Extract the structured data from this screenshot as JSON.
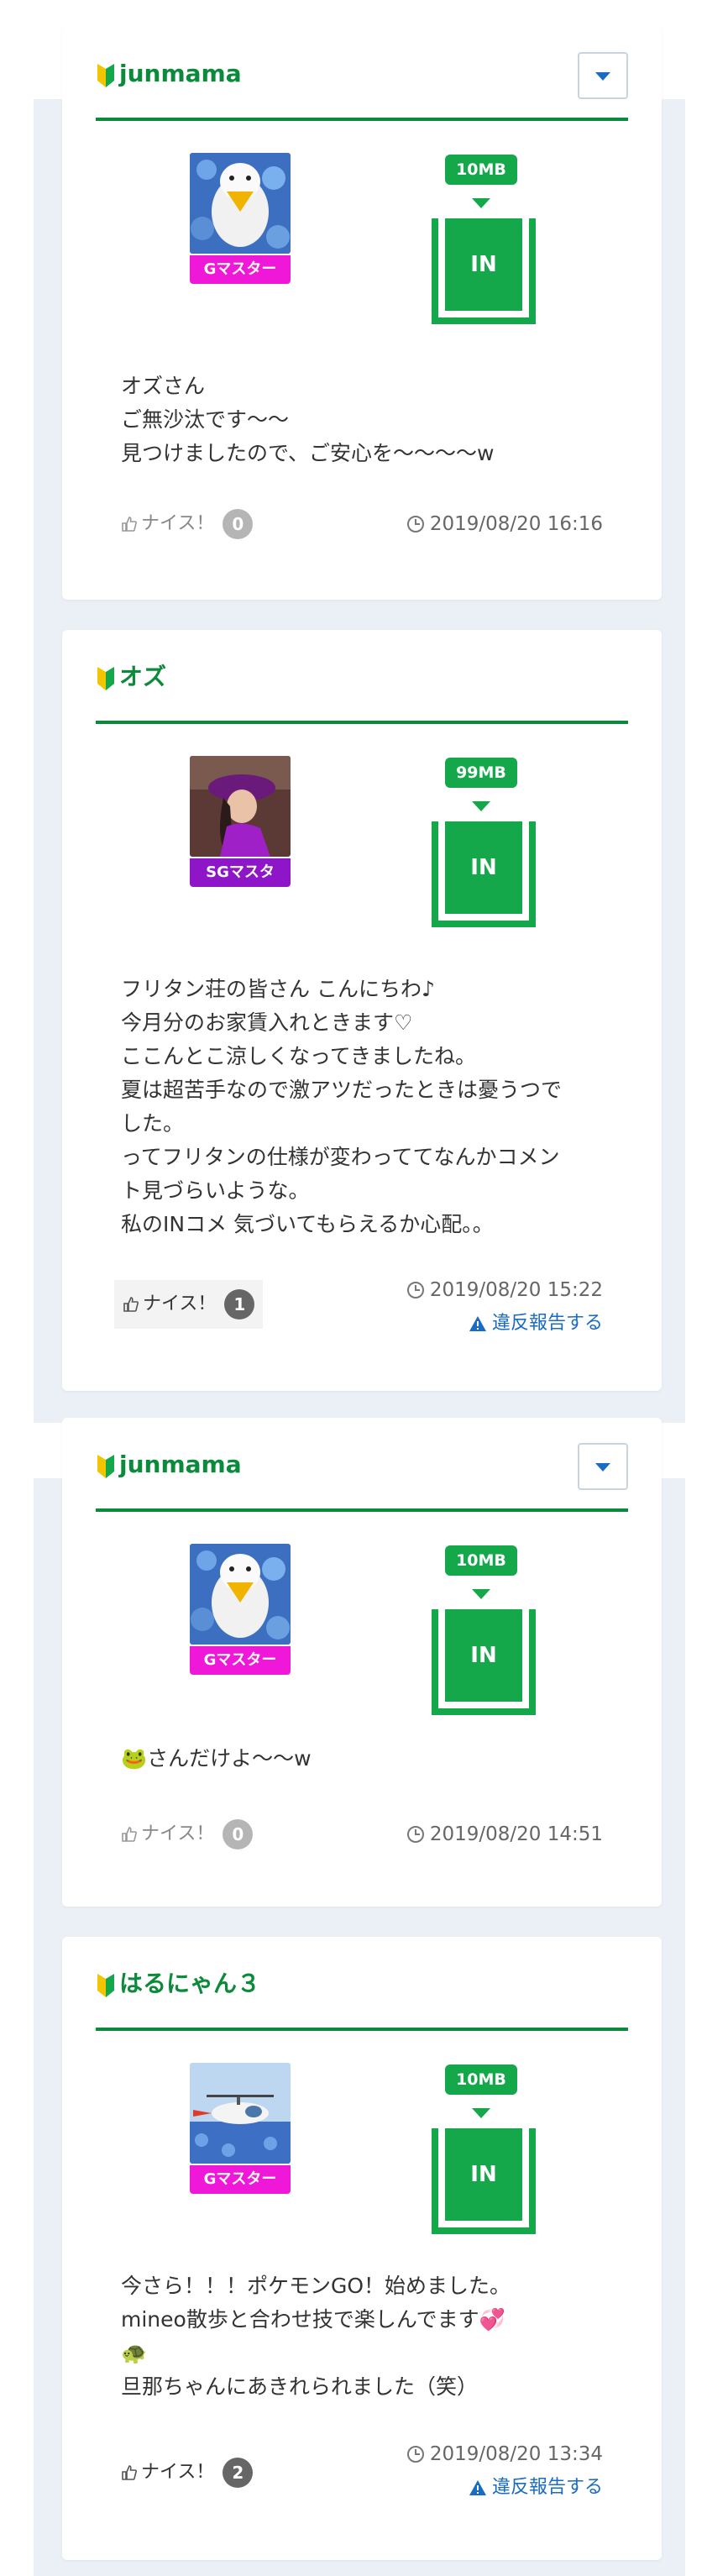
{
  "posts": [
    {
      "username": "junmama",
      "rank": "Gマスター",
      "rank_color": "#f018d8",
      "amount": "10MB",
      "direction": "IN",
      "body": [
        "オズさん",
        "ご無沙汰です〜〜",
        "見つけましたので、ご安心を〜〜〜〜w"
      ],
      "nice_label": "ナイス！",
      "nice_count": "0",
      "timestamp": "2019/08/20 16:16"
    },
    {
      "username": "オズ",
      "rank": "SGマスタ",
      "rank_color": "#8e16c8",
      "amount": "99MB",
      "direction": "IN",
      "body": [
        "フリタン荘の皆さん こんにちわ♪",
        "今月分のお家賃入れときます♡",
        "ここんとこ涼しくなってきましたね。",
        "夏は超苦手なので激アツだったときは憂うつで",
        "した。",
        "ってフリタンの仕様が変わっててなんかコメン",
        "ト見づらいような。",
        "私のINコメ 気づいてもらえるか心配。。"
      ],
      "nice_label": "ナイス！",
      "nice_count": "1",
      "timestamp": "2019/08/20 15:22",
      "report_label": "違反報告する"
    },
    {
      "username": "junmama",
      "rank": "Gマスター",
      "rank_color": "#f018d8",
      "amount": "10MB",
      "direction": "IN",
      "body": [
        "🐸さんだけよ〜〜w"
      ],
      "nice_label": "ナイス！",
      "nice_count": "0",
      "timestamp": "2019/08/20 14:51"
    },
    {
      "username": "はるにゃん３",
      "rank": "Gマスター",
      "rank_color": "#f018d8",
      "amount": "10MB",
      "direction": "IN",
      "body": [
        "今さら！！！ポケモンGO！始めました。",
        "mineo散歩と合わせ技で楽しんでます💞",
        "🐢",
        "旦那ちゃんにあきれられました（笑）"
      ],
      "nice_label": "ナイス！",
      "nice_count": "2",
      "timestamp": "2019/08/20 13:34",
      "report_label": "違反報告する"
    }
  ],
  "icons": {
    "beginner": "beginner-mark-icon",
    "dropdown": "chevron-down-icon",
    "thumb": "thumbs-up-icon",
    "clock": "clock-icon",
    "warning": "warning-icon"
  },
  "colors": {
    "accent_green": "#0a8a3a",
    "badge_green": "#14a84a",
    "link_blue": "#1a6bc2",
    "page_bg": "#eaf0f5"
  }
}
